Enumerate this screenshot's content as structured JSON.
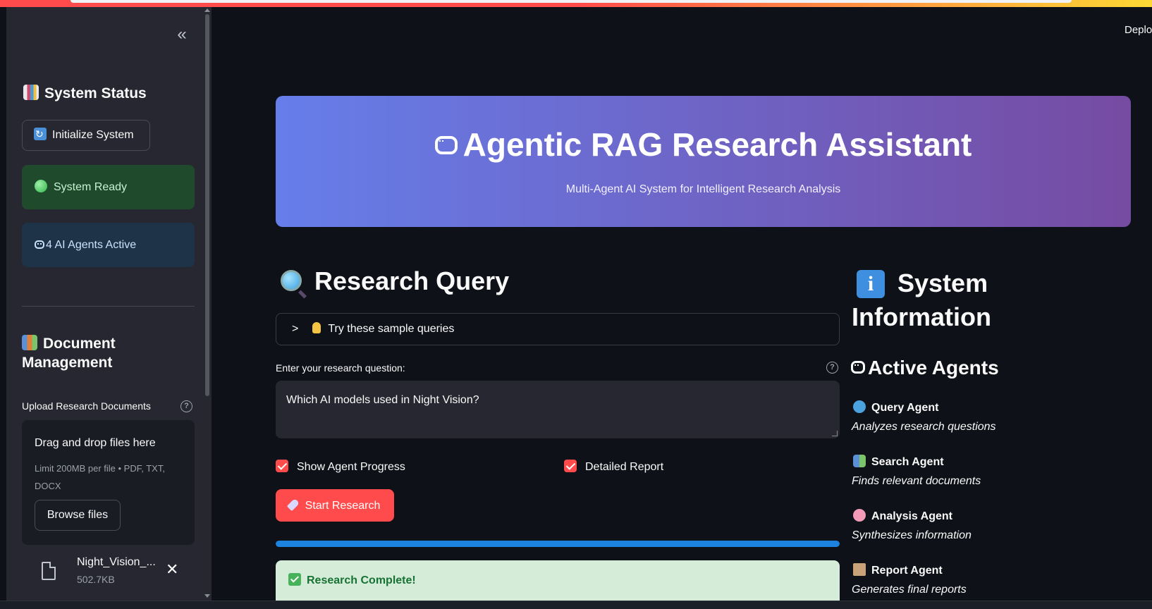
{
  "topbar": {
    "deploy_label": "Deploy"
  },
  "sidebar": {
    "collapse_glyph": "«",
    "status_heading": "System Status",
    "init_button": "Initialize System",
    "status_ready": "System Ready",
    "status_agents": "4 AI Agents Active",
    "docs_heading_line1": "Document",
    "docs_heading_line2": "Management",
    "upload_label": "Upload Research Documents",
    "dropzone": {
      "title": "Drag and drop files here",
      "limit_line1": "Limit 200MB per file • PDF, TXT,",
      "limit_line2": "DOCX",
      "browse_label": "Browse files"
    },
    "file": {
      "name": "Night_Vision_...",
      "size": "502.7KB"
    }
  },
  "hero": {
    "title": "Agentic RAG Research Assistant",
    "subtitle": "Multi-Agent AI System for Intelligent Research Analysis",
    "gradient_start": "#667eea",
    "gradient_end": "#764ba2"
  },
  "query": {
    "heading": "Research Query",
    "sample_expander": "Try these sample queries",
    "input_label": "Enter your research question:",
    "input_value": "Which AI models used in Night Vision?",
    "show_progress_label": "Show Agent Progress",
    "detailed_report_label": "Detailed Report",
    "start_button": "Start Research",
    "progress": 1.0,
    "success_message": "Research Complete!"
  },
  "info": {
    "heading_line1": "System",
    "heading_line2": "Information",
    "agents_heading": "Active Agents",
    "agents": [
      {
        "name": "Query Agent",
        "desc": "Analyzes research questions",
        "icon": "magnifier-icon",
        "color": "#4aa3df"
      },
      {
        "name": "Search Agent",
        "desc": "Finds relevant documents",
        "icon": "books-icon",
        "color": "#5b8fd6"
      },
      {
        "name": "Analysis Agent",
        "desc": "Synthesizes information",
        "icon": "brain-icon",
        "color": "#f29ab8"
      },
      {
        "name": "Report Agent",
        "desc": "Generates final reports",
        "icon": "document-icon",
        "color": "#c9a27a"
      }
    ]
  },
  "colors": {
    "accent": "#ff4b4b",
    "background": "#0e1117",
    "sidebar": "#262730",
    "progress": "#1c83e1",
    "success_bg": "#d5ecd9"
  }
}
